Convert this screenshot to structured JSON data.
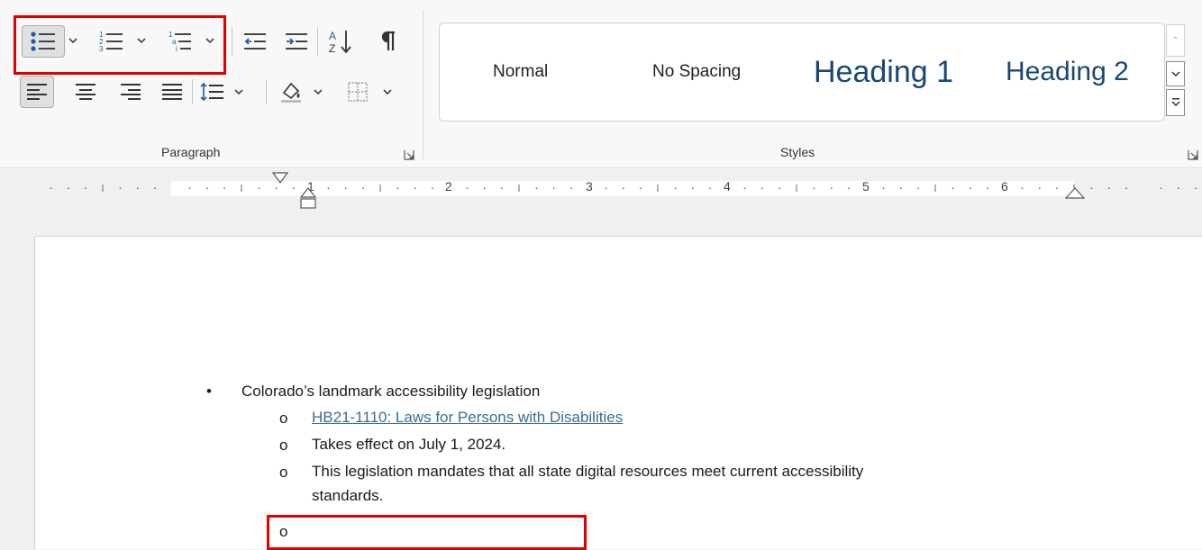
{
  "ribbon": {
    "paragraph_group_label": "Paragraph",
    "styles_group_label": "Styles",
    "icons": {
      "bullets": "bullets-icon",
      "numbering": "numbering-icon",
      "multilevel": "multilevel-list-icon",
      "decrease_indent": "decrease-indent-icon",
      "increase_indent": "increase-indent-icon",
      "sort": "sort-icon",
      "show_marks": "pilcrow-icon",
      "align_left": "align-left-icon",
      "align_center": "align-center-icon",
      "align_right": "align-right-icon",
      "justify": "justify-icon",
      "line_spacing": "line-spacing-icon",
      "shading": "shading-icon",
      "borders": "borders-icon"
    },
    "styles": {
      "normal": "Normal",
      "no_spacing": "No Spacing",
      "heading1": "Heading 1",
      "heading2": "Heading 2"
    }
  },
  "ruler": {
    "numbers": [
      "1",
      "2",
      "3",
      "4",
      "5",
      "6"
    ]
  },
  "document": {
    "bullet_main": "Colorado’s landmark accessibility legislation",
    "sub_link": "HB21-1110: Laws for Persons with Disabilities",
    "sub_effect": "Takes effect on July 1, 2024.",
    "sub_mandate_line1": "This legislation mandates that all state digital resources meet current accessibility",
    "sub_mandate_line2": "standards.",
    "sub_empty": "",
    "bullet_symbol": "•",
    "sub_bullet_symbol": "o"
  },
  "colors": {
    "highlight": "#e00000",
    "heading": "#174874",
    "link": "#3b6e8f"
  }
}
